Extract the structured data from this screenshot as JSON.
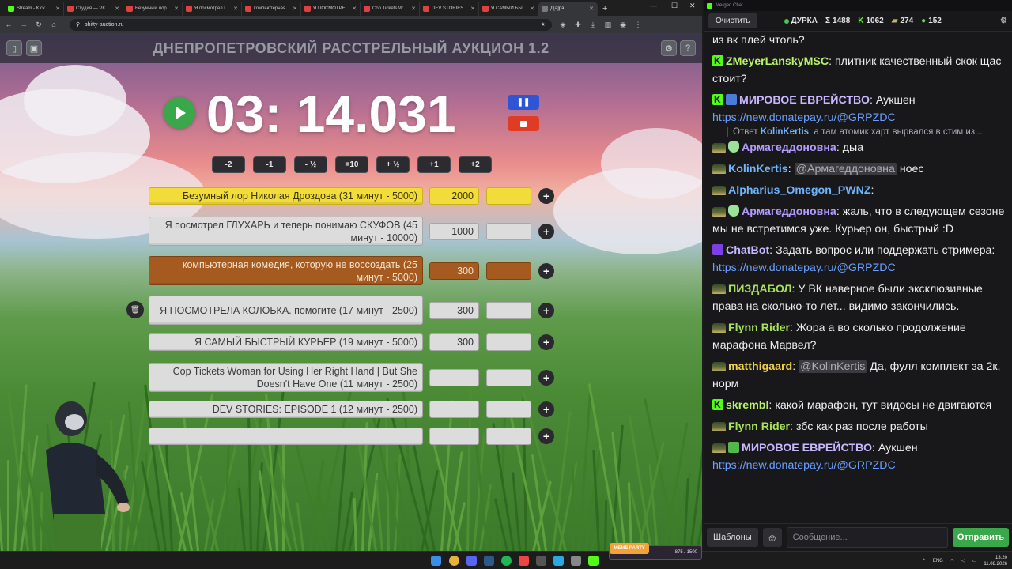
{
  "browser": {
    "tabs": [
      {
        "title": "Stream - Kick",
        "color": "#53fc18"
      },
      {
        "title": "Студия — VK",
        "color": "#e04040"
      },
      {
        "title": "Безумный лор",
        "color": "#e04040"
      },
      {
        "title": "Я посмотрел Г",
        "color": "#e04040"
      },
      {
        "title": "компьютерная",
        "color": "#e04040"
      },
      {
        "title": "Я ПОСМОТРЕ",
        "color": "#e04040"
      },
      {
        "title": "Cop Tickets W",
        "color": "#e04040"
      },
      {
        "title": "DEV STORIES",
        "color": "#e04040"
      },
      {
        "title": "Я САМЫЙ БЫ",
        "color": "#e04040"
      },
      {
        "title": "Д[а]ра",
        "color": "#7a7a7a",
        "active": true
      }
    ],
    "url": "shitty-auction.ru"
  },
  "auction": {
    "title": "ДНЕПРОПЕТРОВСКИЙ РАССТРЕЛЬНЫЙ АУКЦИОН 1.2",
    "timer": "03: 14.031",
    "pause_label": "❚❚",
    "time_buttons": [
      "-2",
      "-1",
      "- ½",
      "=10",
      "+ ½",
      "+1",
      "+2"
    ],
    "lots": [
      {
        "name": "Безумный лор Николая Дроздова (31 минут - 5000)",
        "amount": "2000",
        "style": "gold"
      },
      {
        "name": "Я посмотрел ГЛУХАРЬ и теперь понимаю СКУФОВ (45 минут - 10000)",
        "amount": "1000",
        "style": "plain"
      },
      {
        "name": "компьютерная комедия, которую не воссоздать (25 минут - 5000)",
        "amount": "300",
        "style": "bronze"
      },
      {
        "name": "Я ПОСМОТРЕЛА КОЛОБКА. помогите (17 минут - 2500)",
        "amount": "300",
        "style": "plain"
      },
      {
        "name": "Я САМЫЙ БЫСТРЫЙ КУРЬЕР (19 минут - 5000)",
        "amount": "300",
        "style": "plain"
      },
      {
        "name": "Cop Tickets Woman for Using Her Right Hand | But She Doesn't Have One (11 минут - 2500)",
        "amount": "",
        "style": "plain"
      },
      {
        "name": "DEV STORIES: EPISODE 1 (12 минут - 2500)",
        "amount": "",
        "style": "plain"
      },
      {
        "name": "",
        "amount": "",
        "style": "plain"
      }
    ]
  },
  "chat": {
    "window_title": "Merged Chat",
    "clear_label": "Очистить",
    "channel_name": "ДУРКА",
    "stats": [
      {
        "icon": "sigma",
        "value": "1488"
      },
      {
        "icon": "kick",
        "value": "1062"
      },
      {
        "icon": "hat",
        "value": "274"
      },
      {
        "icon": "frog",
        "value": "152"
      }
    ],
    "messages": [
      {
        "user": "",
        "color": "#efeff1",
        "badges": [],
        "text": "из вк плей чтоль?"
      },
      {
        "user": "ZMeyerLanskyMSC",
        "color": "#b8f26a",
        "badges": [
          "kick"
        ],
        "text": "плитник качественный скок щас стоит?"
      },
      {
        "user": "МИРОВОЕ ЕВРЕЙСТВО",
        "color": "#c8b8ff",
        "badges": [
          "kick",
          "pick"
        ],
        "text": "Аукшен",
        "link": "https://new.donatepay.ru/@GRPZDC"
      },
      {
        "reply": "Ответ",
        "reply_user": "KolinKertis",
        "reply_text": "а там атомик харт вырвался в стим из..."
      },
      {
        "user": "Армагеддоновна",
        "color": "#b49cff",
        "badges": [
          "hat",
          "shield"
        ],
        "text": "дыа"
      },
      {
        "user": "KolinKertis",
        "color": "#6fb6ff",
        "badges": [
          "hat"
        ],
        "mention": "@Армагеддоновна",
        "text": "ноес"
      },
      {
        "user": "Alpharius_Omegon_PWNZ",
        "color": "#6fb6ff",
        "badges": [
          "hat"
        ],
        "text": ""
      },
      {
        "user": "Армагеддоновна",
        "color": "#b49cff",
        "badges": [
          "hat",
          "shield"
        ],
        "text": "жаль, что в следующем сезоне мы не встретимся уже. Курьер он, быстрый :D"
      },
      {
        "user": "ChatBot",
        "color": "#c8b8ff",
        "badges": [
          "bot"
        ],
        "text": "Задать вопрос или поддержать стримера:",
        "link": "https://new.donatepay.ru/@GRPZDC"
      },
      {
        "user": "ПИЗДАБОЛ",
        "color": "#a8e25a",
        "badges": [
          "hat"
        ],
        "text": "У ВК наверное были эксклюзивные права на сколько-то лет... видимо закончились."
      },
      {
        "user": "Flynn Rider",
        "color": "#a8e25a",
        "badges": [
          "hat"
        ],
        "text": "Жора а во сколько продолжение марафона Марвел?"
      },
      {
        "user": "matthigaard",
        "color": "#f0d24a",
        "badges": [
          "hat"
        ],
        "mention": "@KolinKertis",
        "text": "Да, фулл комплект за 2к, норм"
      },
      {
        "user": "skrembl",
        "color": "#b8f26a",
        "badges": [
          "kick"
        ],
        "text": "какой марафон, тут видосы не двигаются"
      },
      {
        "user": "Flynn Rider",
        "color": "#a8e25a",
        "badges": [
          "hat"
        ],
        "text": "збс как раз после работы"
      },
      {
        "user": "МИРОВОЕ ЕВРЕЙСТВО",
        "color": "#c8b8ff",
        "badges": [
          "hat",
          "check"
        ],
        "text": "Аукшен",
        "link": "https://new.donatepay.ru/@GRPZDC"
      }
    ],
    "templates_label": "Шаблоны",
    "input_placeholder": "Сообщение...",
    "send_label": "Отправить"
  },
  "taskbar": {
    "meme_party_label": "MEME PARTY",
    "meme_party_progress": "875 / 1500",
    "lang": "ENG",
    "time": "13:20",
    "date": "11.08.2026"
  }
}
